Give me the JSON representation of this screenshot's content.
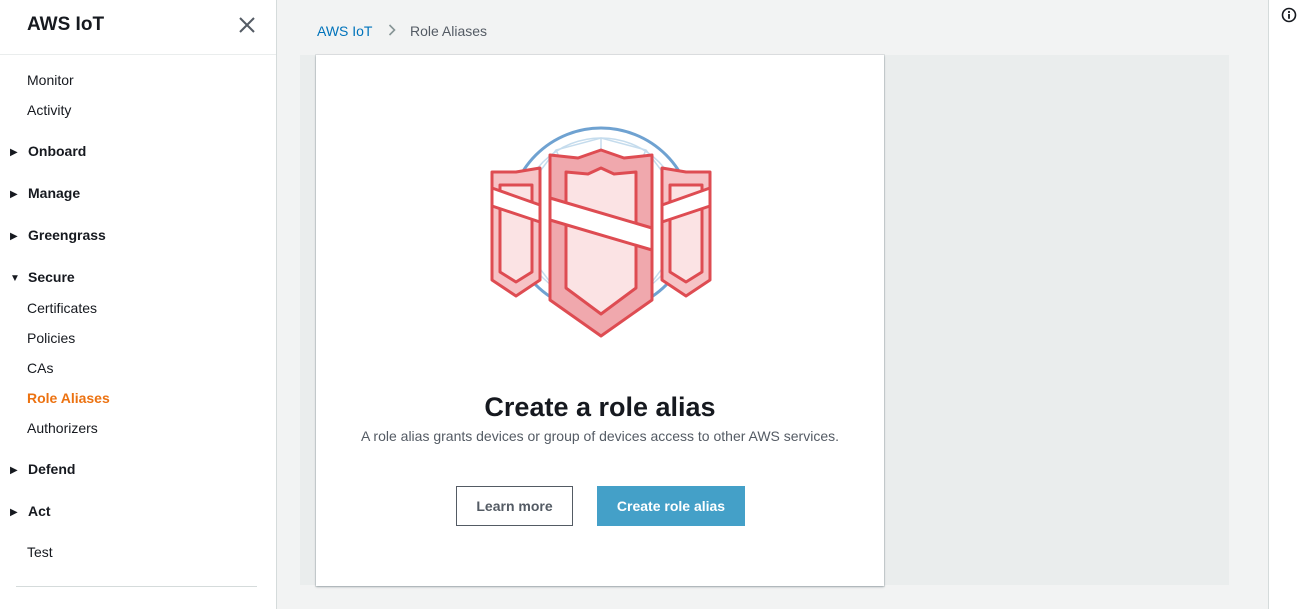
{
  "sidebar": {
    "title": "AWS IoT",
    "items": [
      {
        "label": "Monitor",
        "type": "item"
      },
      {
        "label": "Activity",
        "type": "item"
      },
      {
        "label": "Onboard",
        "type": "section",
        "expanded": false
      },
      {
        "label": "Manage",
        "type": "section",
        "expanded": false
      },
      {
        "label": "Greengrass",
        "type": "section",
        "expanded": false
      },
      {
        "label": "Secure",
        "type": "section",
        "expanded": true
      },
      {
        "label": "Certificates",
        "type": "item"
      },
      {
        "label": "Policies",
        "type": "item"
      },
      {
        "label": "CAs",
        "type": "item"
      },
      {
        "label": "Role Aliases",
        "type": "item",
        "active": true
      },
      {
        "label": "Authorizers",
        "type": "item"
      },
      {
        "label": "Defend",
        "type": "section",
        "expanded": false
      },
      {
        "label": "Act",
        "type": "section",
        "expanded": false
      },
      {
        "label": "Test",
        "type": "item"
      }
    ]
  },
  "breadcrumb": {
    "root": "AWS IoT",
    "current": "Role Aliases"
  },
  "card": {
    "illustration": "role-alias-shield-icon",
    "title": "Create a role alias",
    "subtitle": "A role alias grants devices or group of devices access to other AWS services.",
    "learn_more_label": "Learn more",
    "create_label": "Create role alias"
  },
  "colors": {
    "accent_active": "#ec7211",
    "link": "#0073bb",
    "primary_button": "#44a0c8"
  }
}
